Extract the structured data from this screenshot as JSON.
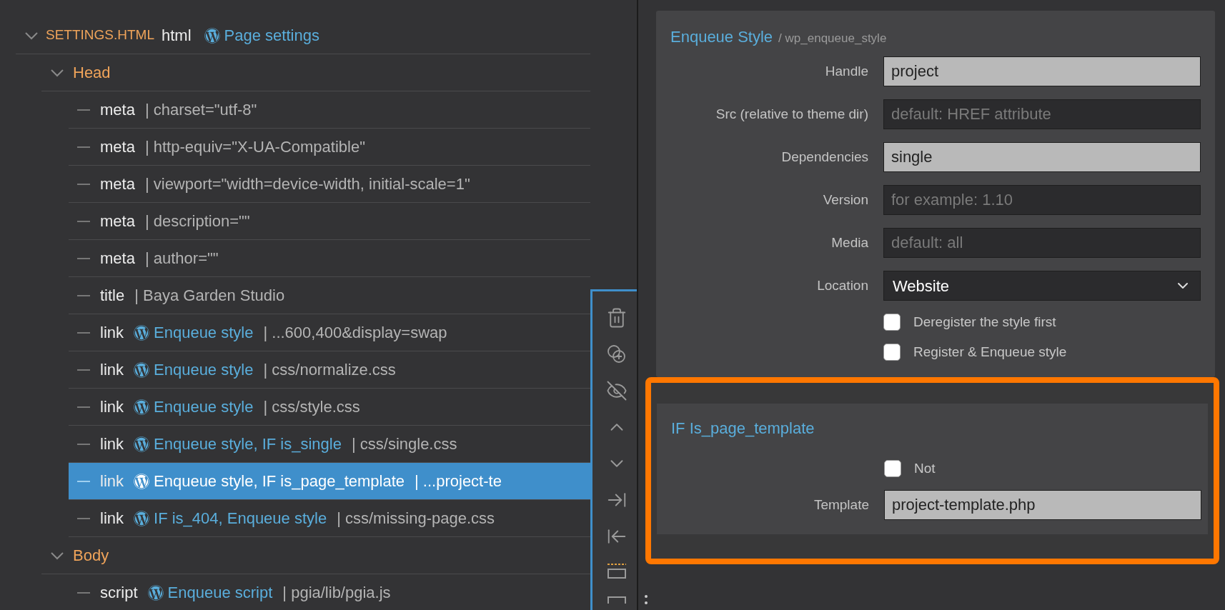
{
  "tree": {
    "file": "SETTINGS.HTML",
    "tag": "html",
    "wp_label": "Page settings",
    "expanded": true,
    "children": [
      {
        "label": "Head",
        "expanded": true,
        "children": [
          {
            "tag": "meta",
            "detail": "| charset=\"utf-8\"",
            "selected": false
          },
          {
            "tag": "meta",
            "detail": "| http-equiv=\"X-UA-Compatible\"",
            "selected": false
          },
          {
            "tag": "meta",
            "detail": "| viewport=\"width=device-width, initial-scale=1\"",
            "selected": false
          },
          {
            "tag": "meta",
            "detail": "| description=\"\"",
            "selected": false
          },
          {
            "tag": "meta",
            "detail": "| author=\"\"",
            "selected": false
          },
          {
            "tag": "title",
            "detail": "| Baya Garden Studio",
            "selected": false
          },
          {
            "tag": "link",
            "wp_label": "Enqueue style",
            "detail": "| ...600,400&display=swap",
            "selected": false
          },
          {
            "tag": "link",
            "wp_label": "Enqueue style",
            "detail": "| css/normalize.css",
            "selected": false
          },
          {
            "tag": "link",
            "wp_label": "Enqueue style",
            "detail": "| css/style.css",
            "selected": false
          },
          {
            "tag": "link",
            "wp_label": "Enqueue style, IF is_single",
            "detail": "| css/single.css",
            "selected": false
          },
          {
            "tag": "link",
            "wp_label": "Enqueue style, IF is_page_template",
            "detail": "| ...project-te",
            "selected": true
          },
          {
            "tag": "link",
            "wp_label": "IF is_404, Enqueue style",
            "detail": "| css/missing-page.css",
            "selected": false
          }
        ]
      },
      {
        "label": "Body",
        "expanded": true,
        "children": [
          {
            "tag": "script",
            "wp_label": "Enqueue script",
            "detail": "| pgia/lib/pgia.js",
            "selected": false
          }
        ]
      }
    ]
  },
  "style_panel": {
    "title": "Enqueue Style",
    "subtitle": "/ wp_enqueue_style",
    "fields": [
      {
        "kind": "text",
        "label": "Handle",
        "value": "project"
      },
      {
        "kind": "text",
        "label": "Src (relative to theme dir)",
        "placeholder": "default: HREF attribute"
      },
      {
        "kind": "text",
        "label": "Dependencies",
        "value": "single"
      },
      {
        "kind": "text",
        "label": "Version",
        "placeholder": "for example: 1.10"
      },
      {
        "kind": "text",
        "label": "Media",
        "placeholder": "default: all"
      },
      {
        "kind": "select",
        "label": "Location",
        "value": "Website"
      },
      {
        "kind": "checkbox",
        "label": "Deregister the style first",
        "checked": false
      },
      {
        "kind": "checkbox",
        "label": "Register & Enqueue style",
        "checked": false
      }
    ]
  },
  "condition_panel": {
    "title": "IF Is_page_template",
    "highlighted": true,
    "fields": [
      {
        "kind": "checkbox",
        "label": "Not",
        "checked": false
      },
      {
        "kind": "text",
        "label": "Template",
        "value": "project-template.php"
      }
    ]
  }
}
